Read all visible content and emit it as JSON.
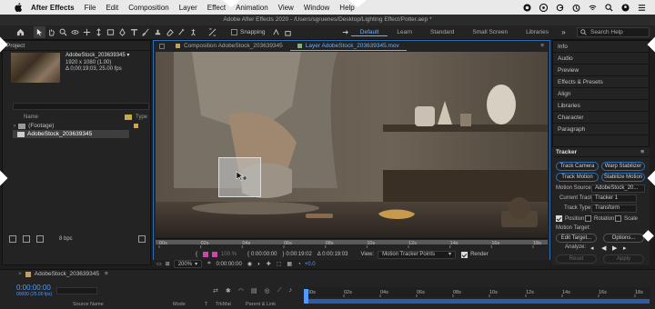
{
  "menubar": {
    "app_name": "After Effects",
    "items": [
      "File",
      "Edit",
      "Composition",
      "Layer",
      "Effect",
      "Animation",
      "View",
      "Window",
      "Help"
    ]
  },
  "window_title": "Adobe After Effects 2020 - /Users/sgruenes/Desktop/Lighting Effect/Potter.aep *",
  "toolbar": {
    "snapping_label": "Snapping",
    "workspaces": [
      "Default",
      "Learn",
      "Standard",
      "Small Screen",
      "Libraries"
    ],
    "active_workspace": "Default",
    "search_placeholder": "Search Help"
  },
  "project": {
    "panel_title": "Project",
    "footage_name": "AdobeStock_203639345 ▾",
    "footage_res": "1920 x 1080 (1.00)",
    "footage_duration": "Δ 0;00;19;03, 25.00 fps",
    "col_name": "Name",
    "col_type": "Type",
    "rows": [
      "(Footage)",
      "AdobeStock_203639345"
    ],
    "bpc": "8 bpc"
  },
  "viewer": {
    "tab_composition": "Composition AdobeStock_203639345",
    "tab_layer": "Layer AdobeStock_203639345.mov",
    "ruler_ticks": [
      "00s",
      "02s",
      "04s",
      "06s",
      "08s",
      "10s",
      "12s",
      "14s",
      "16s",
      "18s"
    ],
    "tc_in": "0:00:00:00",
    "tc_out": "0:00:19:02",
    "tc_dur": "Δ 0:00:19:03",
    "view_label": "View:",
    "view_value": "Motion Tracker Points",
    "render_label": "Render",
    "zoom": "200%",
    "current_time": "0:00:00:00",
    "exposure": "+0.0",
    "opacity": "100 %"
  },
  "right_panels": {
    "items": [
      "Info",
      "Audio",
      "Preview",
      "Effects & Presets",
      "Align",
      "Libraries",
      "Character",
      "Paragraph"
    ]
  },
  "tracker": {
    "title": "Tracker",
    "track_camera": "Track Camera",
    "warp_stabilizer": "Warp Stabilizer",
    "track_motion": "Track Motion",
    "stabilize_motion": "Stabilize Motion",
    "motion_source_label": "Motion Source:",
    "motion_source_value": "AdobeStock_20...",
    "current_track_label": "Current Track:",
    "current_track_value": "Tracker 1",
    "track_type_label": "Track Type:",
    "track_type_value": "Transform",
    "position_label": "Position",
    "rotation_label": "Rotation",
    "scale_label": "Scale",
    "motion_target_label": "Motion Target:",
    "edit_target": "Edit Target...",
    "options": "Options...",
    "analyze_label": "Analyze:",
    "reset": "Reset",
    "apply": "Apply"
  },
  "timeline": {
    "tab_name": "AdobeStock_203639345",
    "current_time": "0:00:00:00",
    "fps_note": "00000 (25.00 fps)",
    "cols": {
      "source_name": "Source Name",
      "mode": "Mode",
      "t": "T",
      "trkmat": "TrkMat",
      "parent": "Parent & Link"
    },
    "ruler_ticks": [
      "00s",
      "02s",
      "04s",
      "06s",
      "08s",
      "10s",
      "12s",
      "14s",
      "16s",
      "18s"
    ]
  }
}
